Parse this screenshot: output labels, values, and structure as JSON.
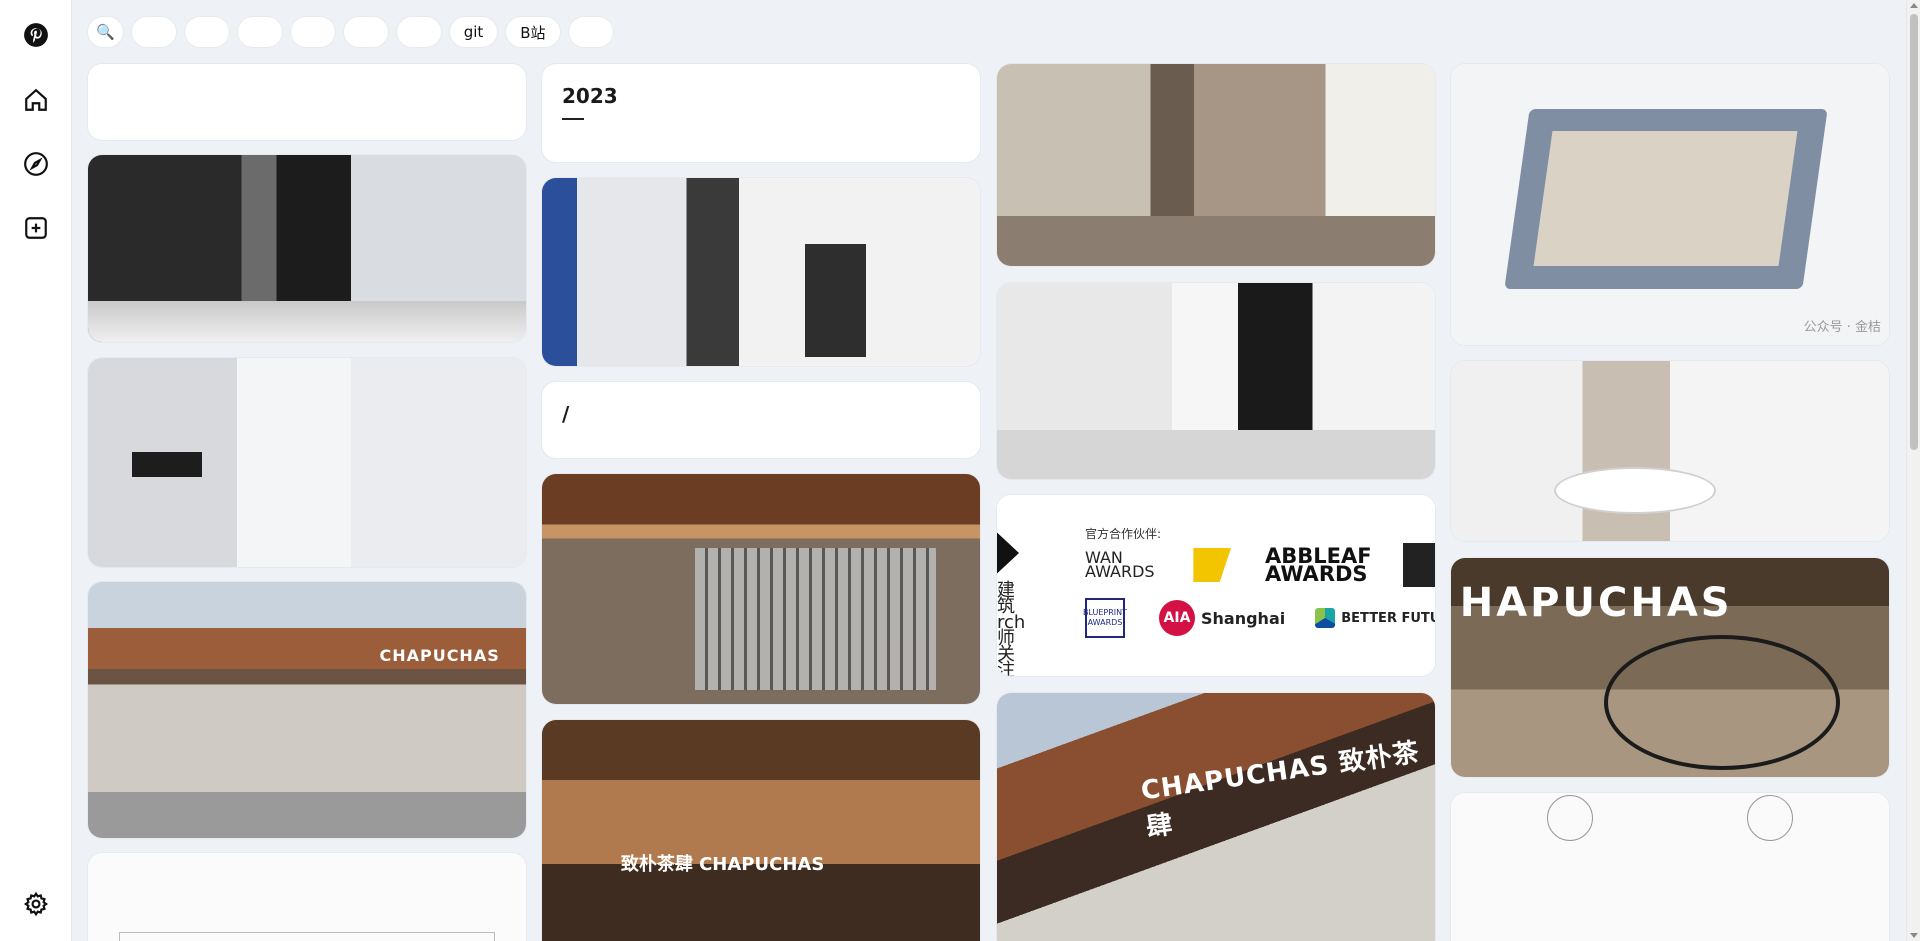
{
  "sidebar": {
    "icons": [
      {
        "name": "pinterest-logo-icon"
      },
      {
        "name": "home-icon"
      },
      {
        "name": "compass-icon"
      },
      {
        "name": "create-plus-icon"
      },
      {
        "name": "settings-gear-icon"
      }
    ]
  },
  "chips": {
    "search_icon": "🔍",
    "items": [
      "    ",
      "    ",
      "    ",
      "    ",
      "    ",
      "    ",
      "git",
      "B站",
      "    "
    ]
  },
  "cards": {
    "col1_title": "       ",
    "col2_title": "    2023    ",
    "col2_title2": "      /      ",
    "facade_sign": "CHAPUCHAS",
    "interior_sign": "致朴茶肆 CHAPUCHAS",
    "facade2_sign": "CHAPUCHAS 致朴茶肆",
    "plan_watermark": "公众号 · 金桔",
    "tree_sign": "HAPUCHAS"
  },
  "partners": {
    "header": "官方合作伙伴:",
    "left_text": "建筑 rch 师关注",
    "wan": "WAN AWARDS",
    "abb": "ABBLEAF AWARDS",
    "blueprint": "BLUEPRINT AWARDS",
    "aia_badge": "AIA",
    "aia_label": "Shanghai",
    "better": "BETTER FUTU"
  }
}
